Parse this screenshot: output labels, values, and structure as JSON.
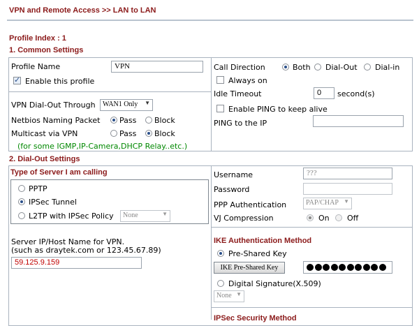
{
  "breadcrumb": "VPN and Remote Access >> LAN to LAN",
  "profile_index": "Profile Index : 1",
  "sections": {
    "common": "1. Common Settings",
    "dialout": "2. Dial-Out Settings",
    "ipsec": "IPSec Security Method"
  },
  "common": {
    "profile_name_label": "Profile Name",
    "profile_name_value": "VPN",
    "enable_profile_label": "Enable this profile",
    "dialout_through_label": "VPN Dial-Out Through",
    "dialout_through_value": "WAN1 Only",
    "netbios_label": "Netbios Naming Packet",
    "multicast_label": "Multicast via VPN",
    "pass_label": "Pass",
    "block_label": "Block",
    "multicast_note": "(for some IGMP,IP-Camera,DHCP Relay..etc.)",
    "call_direction_label": "Call Direction",
    "both_label": "Both",
    "dialout_label": "Dial-Out",
    "dialin_label": "Dial-in",
    "always_on_label": "Always on",
    "idle_timeout_label": "Idle Timeout",
    "idle_timeout_value": "0",
    "idle_unit": "second(s)",
    "enable_ping_label": "Enable PING to keep alive",
    "ping_ip_label": "PING to the IP",
    "ping_ip_value": ""
  },
  "dialout": {
    "server_type_title": "Type of Server I am calling",
    "pptp_label": "PPTP",
    "ipsec_label": "IPSec Tunnel",
    "l2tp_label": "L2TP with IPSec Policy",
    "l2tp_policy_value": "None",
    "server_host_label_1": "Server IP/Host Name for VPN.",
    "server_host_label_2": "(such as draytek.com or 123.45.67.89)",
    "server_host_value": "59.125.9.159",
    "username_label": "Username",
    "username_value": "???",
    "password_label": "Password",
    "ppp_auth_label": "PPP Authentication",
    "ppp_auth_value": "PAP/CHAP",
    "vj_label": "VJ Compression",
    "on_label": "On",
    "off_label": "Off",
    "ike_title": "IKE Authentication Method",
    "psk_label": "Pre-Shared Key",
    "ike_psk_button": "IKE Pre-Shared Key",
    "digital_sig_label": "Digital Signature(X.509)",
    "digital_sig_value": "None"
  }
}
